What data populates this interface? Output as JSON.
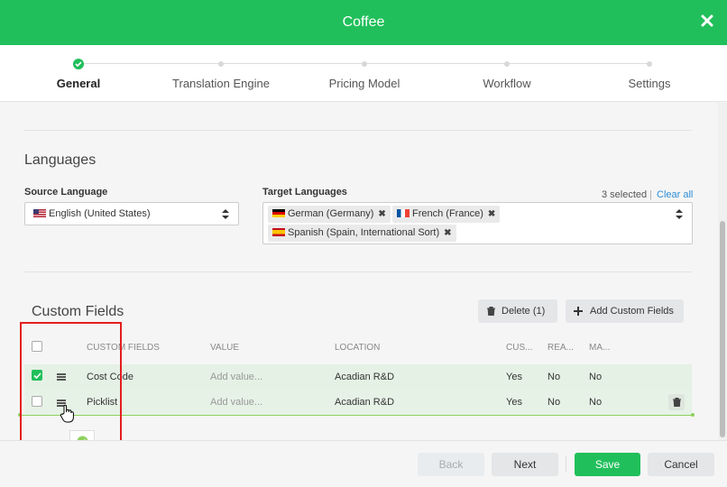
{
  "window": {
    "title": "Coffee"
  },
  "stepper": {
    "steps": [
      {
        "label": "General",
        "active": true
      },
      {
        "label": "Translation Engine",
        "active": false
      },
      {
        "label": "Pricing Model",
        "active": false
      },
      {
        "label": "Workflow",
        "active": false
      },
      {
        "label": "Settings",
        "active": false
      }
    ]
  },
  "languages": {
    "title": "Languages",
    "source_label": "Source Language",
    "source_value": "English (United States)",
    "target_label": "Target Languages",
    "selected_count": "3 selected",
    "separator": "|",
    "clear_all": "Clear all",
    "targets": [
      {
        "label": "German (Germany)",
        "flag": "de"
      },
      {
        "label": "French (France)",
        "flag": "fr"
      },
      {
        "label": "Spanish (Spain, International Sort)",
        "flag": "es"
      }
    ]
  },
  "custom_fields": {
    "title": "Custom Fields",
    "delete_label": "Delete (1)",
    "add_label": "Add Custom Fields",
    "columns": [
      "CUSTOM FIELDS",
      "VALUE",
      "LOCATION",
      "CUS...",
      "REA...",
      "MA..."
    ],
    "rows": [
      {
        "name": "Cost Code",
        "value_placeholder": "Add value...",
        "location": "Acadian R&D",
        "c1": "Yes",
        "c2": "No",
        "c3": "No",
        "checked": true
      },
      {
        "name": "Picklist",
        "value_placeholder": "Add value...",
        "location": "Acadian R&D",
        "c1": "Yes",
        "c2": "No",
        "c3": "No",
        "checked": false
      }
    ]
  },
  "footer": {
    "back": "Back",
    "next": "Next",
    "save": "Save",
    "cancel": "Cancel"
  },
  "colors": {
    "brand": "#21bf5b",
    "link": "#2f8fd8",
    "highlight": "#e41e1e"
  }
}
